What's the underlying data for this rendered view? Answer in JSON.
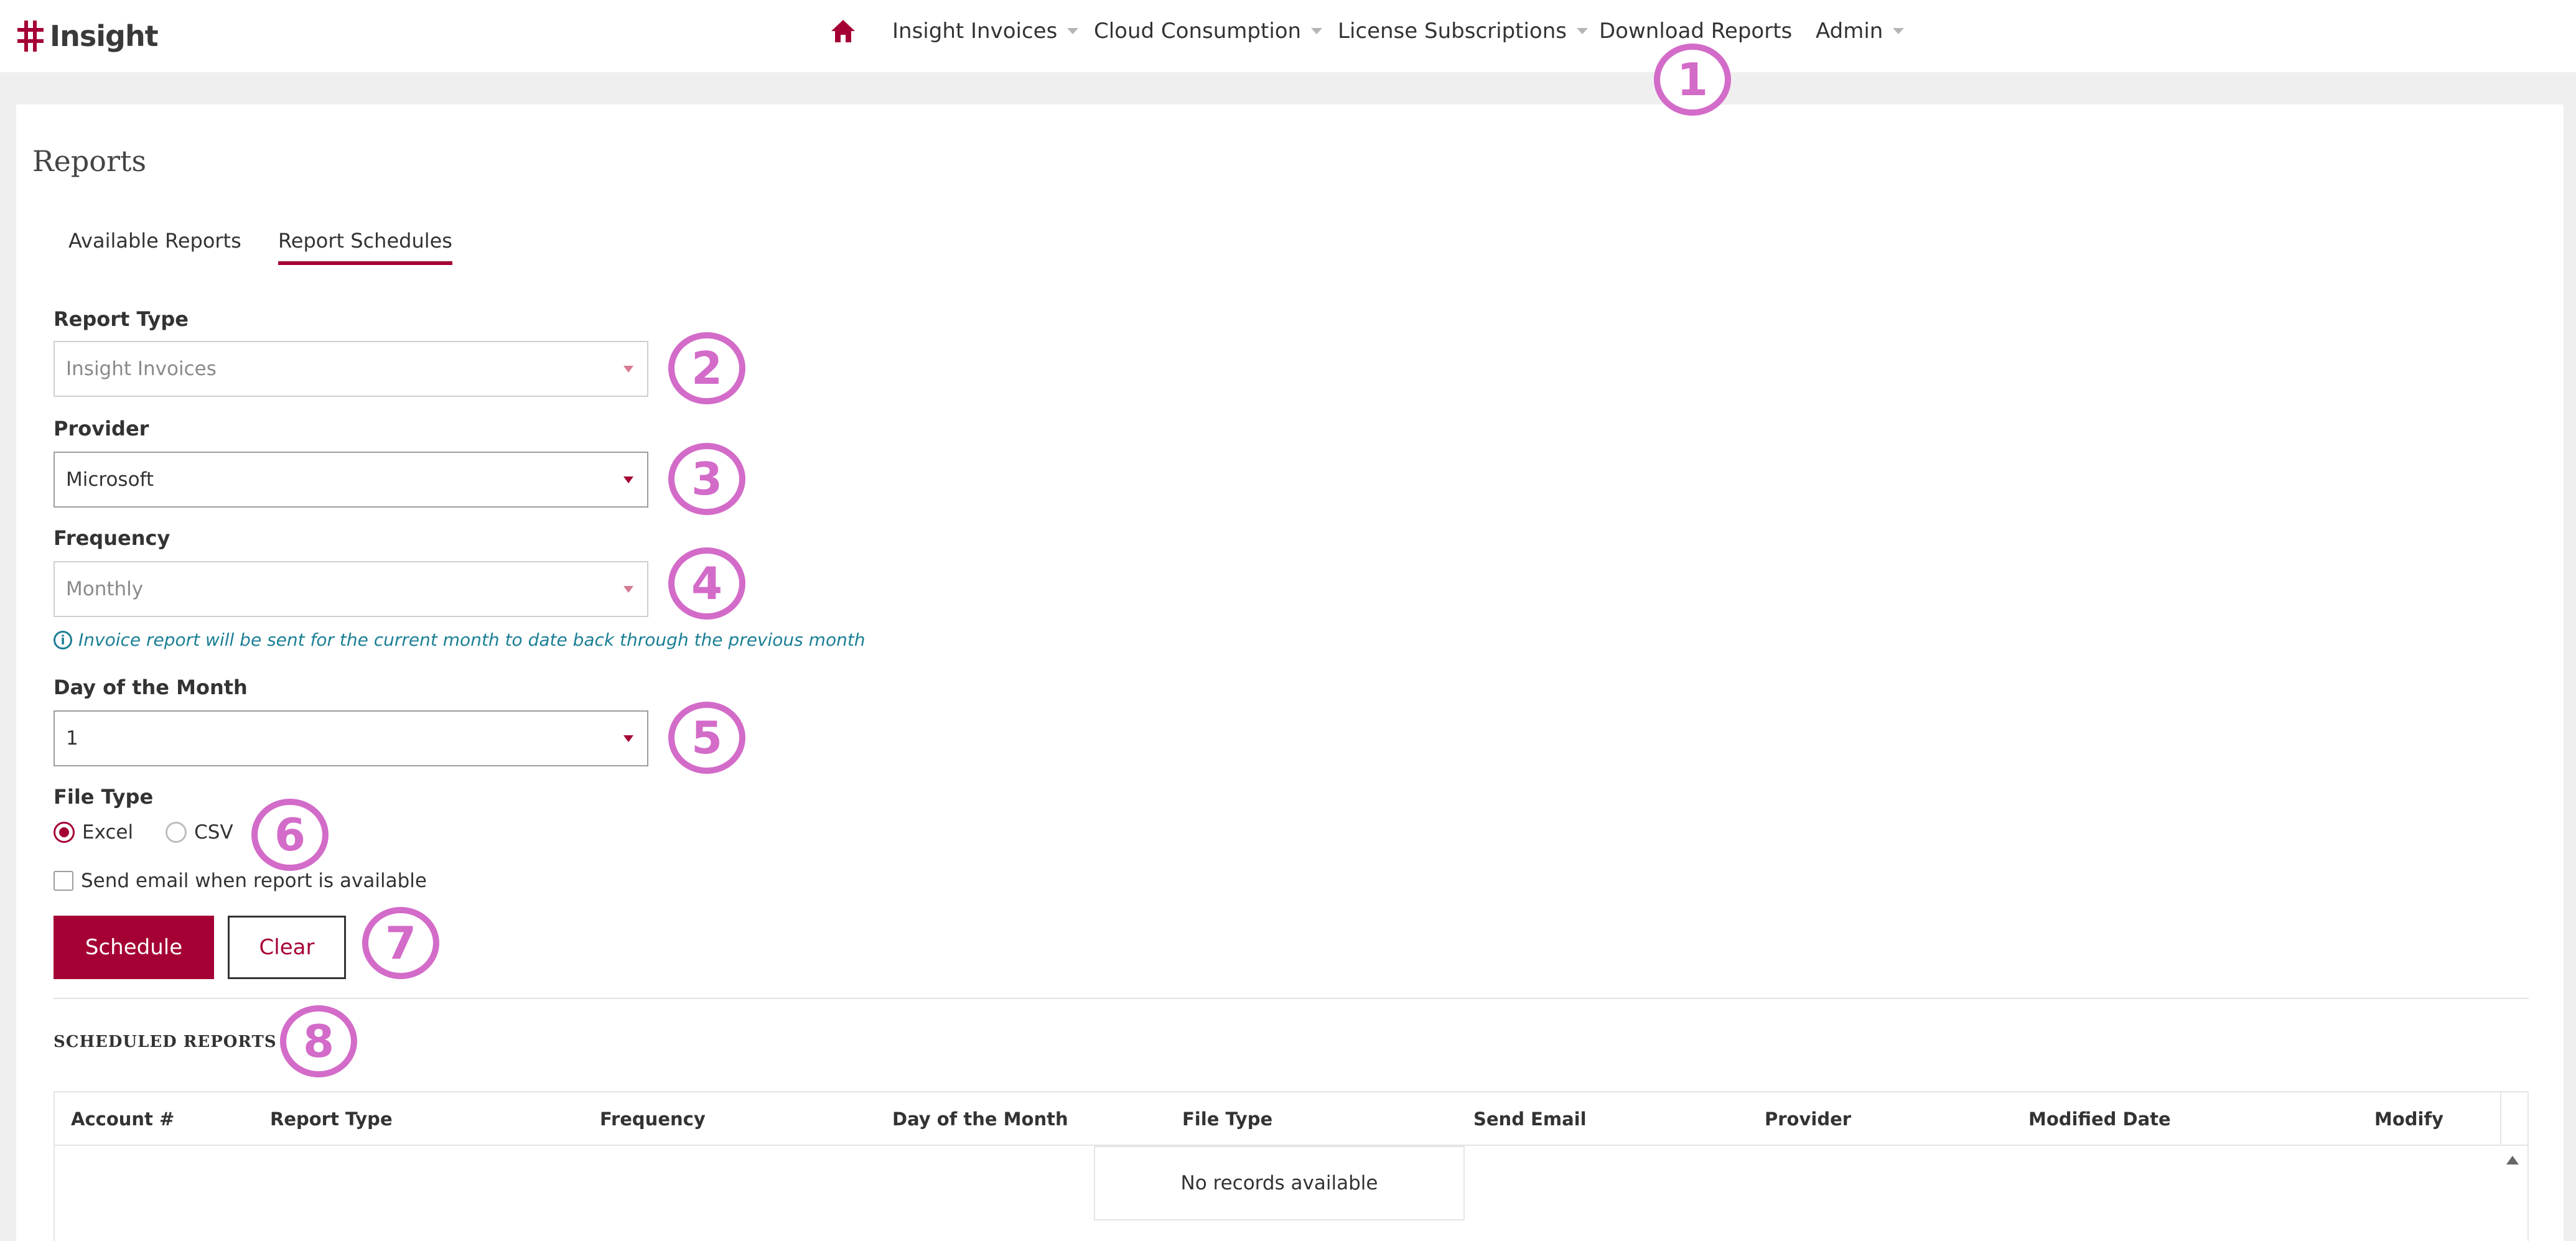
{
  "brand": {
    "name": "Insight",
    "color": "#a50034"
  },
  "nav": {
    "home_icon": "home-icon",
    "items": [
      {
        "label": "Insight Invoices",
        "dropdown": true
      },
      {
        "label": "Cloud Consumption",
        "dropdown": true
      },
      {
        "label": "License Subscriptions",
        "dropdown": true
      },
      {
        "label": "Download Reports",
        "dropdown": false
      },
      {
        "label": "Admin",
        "dropdown": true
      }
    ]
  },
  "page": {
    "title": "Reports",
    "tabs": [
      {
        "label": "Available Reports",
        "active": false
      },
      {
        "label": "Report Schedules",
        "active": true
      }
    ]
  },
  "form": {
    "report_type": {
      "label": "Report Type",
      "value": "Insight Invoices"
    },
    "provider": {
      "label": "Provider",
      "value": "Microsoft"
    },
    "frequency": {
      "label": "Frequency",
      "value": "Monthly"
    },
    "info_text": "Invoice report will be sent for the current month to date back through the previous month",
    "day_of_month": {
      "label": "Day of the Month",
      "value": "1"
    },
    "file_type": {
      "label": "File Type",
      "options": [
        {
          "label": "Excel",
          "checked": true
        },
        {
          "label": "CSV",
          "checked": false
        }
      ]
    },
    "send_email": {
      "label": "Send email when report is available",
      "checked": false
    },
    "schedule_button": "Schedule",
    "clear_button": "Clear"
  },
  "scheduled_reports": {
    "title": "SCHEDULED REPORTS",
    "columns": [
      "Account #",
      "Report Type",
      "Frequency",
      "Day of the Month",
      "File Type",
      "Send Email",
      "Provider",
      "Modified Date",
      "Modify"
    ],
    "empty_text": "No records available"
  },
  "markers": [
    "1",
    "2",
    "3",
    "4",
    "5",
    "6",
    "7",
    "8"
  ]
}
